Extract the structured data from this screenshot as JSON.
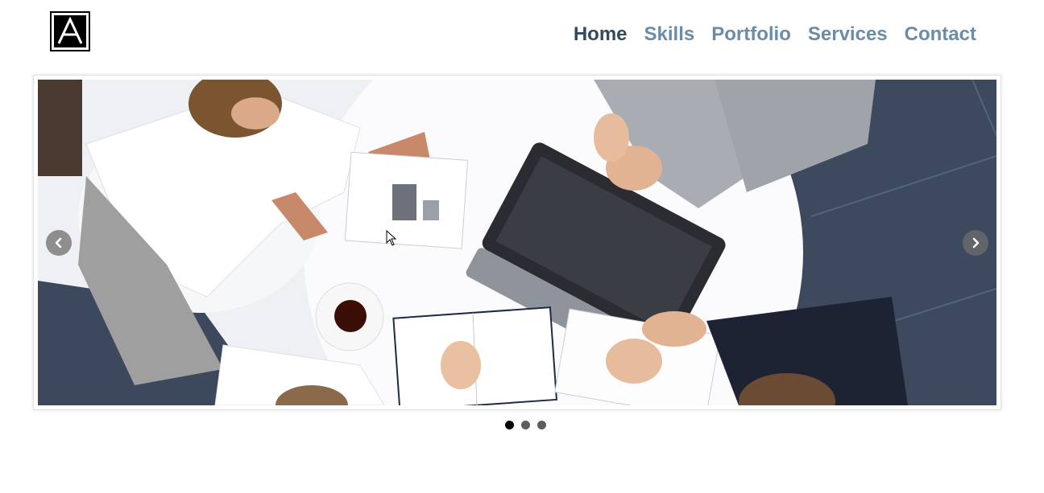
{
  "nav": {
    "items": [
      {
        "label": "Home",
        "active": true
      },
      {
        "label": "Skills"
      },
      {
        "label": "Portfolio"
      },
      {
        "label": "Services"
      },
      {
        "label": "Contact"
      }
    ],
    "active_color": "#35495c",
    "link_color": "#6a8ca8"
  },
  "logo": {
    "letter": "A"
  },
  "slider": {
    "prev_icon": "chevron-left-icon",
    "next_icon": "chevron-right-icon",
    "current_slide": 1,
    "slide_count": 3
  }
}
